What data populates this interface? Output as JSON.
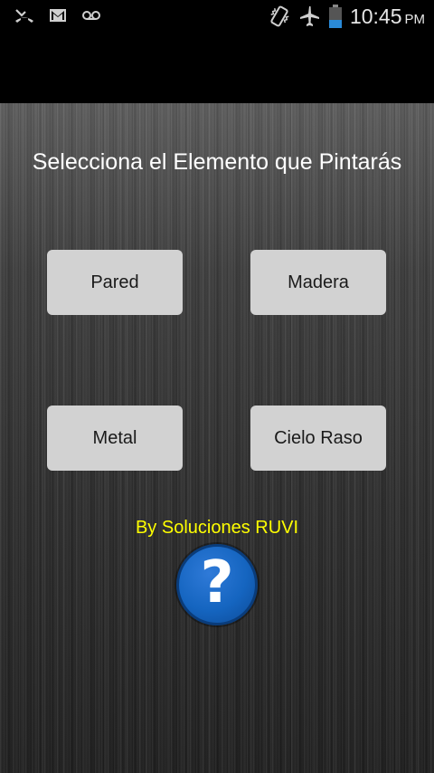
{
  "status_bar": {
    "time": "10:45",
    "ampm": "PM",
    "icons": [
      "missed-call-icon",
      "gmail-icon",
      "voicemail-icon",
      "vibrate-icon",
      "airplane-mode-icon",
      "battery-icon"
    ]
  },
  "main": {
    "title": "Selecciona el Elemento que Pintarás",
    "buttons": {
      "pared": "Pared",
      "madera": "Madera",
      "metal": "Metal",
      "cielo_raso": "Cielo Raso"
    },
    "credit": "By Soluciones RUVI",
    "help_glyph": "?"
  },
  "colors": {
    "credit": "#ffff00",
    "button_bg": "#d2d2d2",
    "help_blue": "#1565c0"
  }
}
